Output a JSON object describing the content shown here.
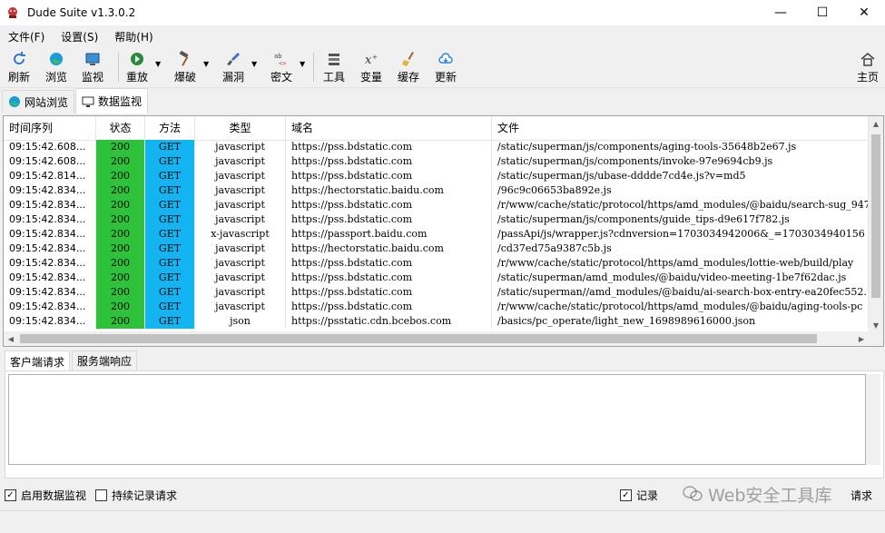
{
  "window": {
    "title": "Dude Suite v1.3.0.2",
    "minimize": "—",
    "maximize": "☐",
    "close": "✕"
  },
  "menu": [
    "文件(F)",
    "设置(S)",
    "帮助(H)"
  ],
  "toolbar": {
    "refresh": "刷新",
    "browse": "浏览",
    "monitor": "监视",
    "replay": "重放",
    "brute": "爆破",
    "vuln": "漏洞",
    "crypto": "密文",
    "tools": "工具",
    "vars": "变量",
    "cache": "缓存",
    "update": "更新",
    "home": "主页"
  },
  "main_tabs": [
    "网站浏览",
    "数据监视"
  ],
  "table": {
    "columns": [
      "时间序列",
      "状态",
      "方法",
      "类型",
      "域名",
      "文件"
    ],
    "rows": [
      [
        "09:15:42.608...",
        "200",
        "GET",
        "javascript",
        "https://pss.bdstatic.com",
        "/static/superman/js/components/aging-tools-35648b2e67.js"
      ],
      [
        "09:15:42.608...",
        "200",
        "GET",
        "javascript",
        "https://pss.bdstatic.com",
        "/static/superman/js/components/invoke-97e9694cb9.js"
      ],
      [
        "09:15:42.814...",
        "200",
        "GET",
        "javascript",
        "https://pss.bdstatic.com",
        "/static/superman/js/ubase-dddde7cd4e.js?v=md5"
      ],
      [
        "09:15:42.834...",
        "200",
        "GET",
        "javascript",
        "https://hectorstatic.baidu.com",
        "/96c9c06653ba892e.js"
      ],
      [
        "09:15:42.834...",
        "200",
        "GET",
        "javascript",
        "https://pss.bdstatic.com",
        "/r/www/cache/static/protocol/https/amd_modules/@baidu/search-sug_947"
      ],
      [
        "09:15:42.834...",
        "200",
        "GET",
        "javascript",
        "https://pss.bdstatic.com",
        "/static/superman/js/components/guide_tips-d9e617f782.js"
      ],
      [
        "09:15:42.834...",
        "200",
        "GET",
        "x-javascript",
        "https://passport.baidu.com",
        "/passApi/js/wrapper.js?cdnversion=1703034942006&_=1703034940156"
      ],
      [
        "09:15:42.834...",
        "200",
        "GET",
        "javascript",
        "https://hectorstatic.baidu.com",
        "/cd37ed75a9387c5b.js"
      ],
      [
        "09:15:42.834...",
        "200",
        "GET",
        "javascript",
        "https://pss.bdstatic.com",
        "/r/www/cache/static/protocol/https/amd_modules/lottie-web/build/play"
      ],
      [
        "09:15:42.834...",
        "200",
        "GET",
        "javascript",
        "https://pss.bdstatic.com",
        "/static/superman/amd_modules/@baidu/video-meeting-1be7f62dac.js"
      ],
      [
        "09:15:42.834...",
        "200",
        "GET",
        "javascript",
        "https://pss.bdstatic.com",
        "/static/superman//amd_modules/@baidu/ai-search-box-entry-ea20fec552."
      ],
      [
        "09:15:42.834...",
        "200",
        "GET",
        "javascript",
        "https://pss.bdstatic.com",
        "/r/www/cache/static/protocol/https/amd_modules/@baidu/aging-tools-pc"
      ],
      [
        "09:15:42.834...",
        "200",
        "GET",
        "json",
        "https://psstatic.cdn.bcebos.com",
        "/basics/pc_operate/light_new_1698989616000.json"
      ]
    ]
  },
  "detail_tabs": [
    "客户端请求",
    "服务端响应"
  ],
  "bottom": {
    "enable_monitor": "启用数据监视",
    "continuous_record": "持续记录请求",
    "record_prefix": "记录",
    "record_suffix": "请求",
    "watermark": "Web安全工具库"
  },
  "colors": {
    "status_bg": "#2ec13a",
    "method_bg": "#13b4f2"
  }
}
